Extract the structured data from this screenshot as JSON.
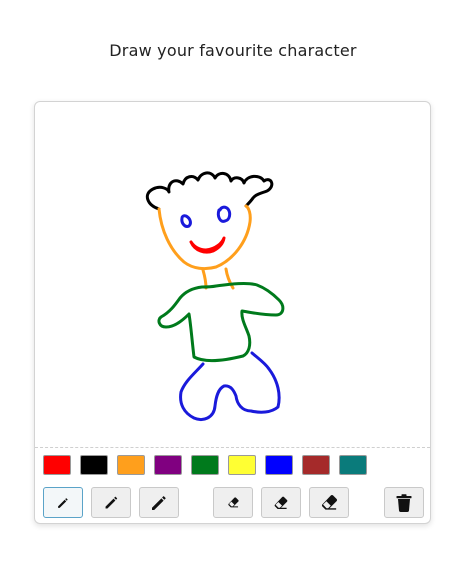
{
  "prompt": "Draw your favourite character",
  "palette": [
    {
      "name": "red",
      "color": "#ff0000"
    },
    {
      "name": "black",
      "color": "#000000"
    },
    {
      "name": "orange",
      "color": "#ff9f1c"
    },
    {
      "name": "purple",
      "color": "#800080"
    },
    {
      "name": "green",
      "color": "#007a1c"
    },
    {
      "name": "yellow",
      "color": "#ffff33"
    },
    {
      "name": "blue",
      "color": "#0000ff"
    },
    {
      "name": "brown",
      "color": "#a52a2a"
    },
    {
      "name": "teal",
      "color": "#0a7b7b"
    }
  ],
  "tools": {
    "pencil_small": {
      "icon": "pencil-icon",
      "size": "small",
      "selected": true
    },
    "pencil_medium": {
      "icon": "pencil-icon",
      "size": "medium",
      "selected": false
    },
    "pencil_large": {
      "icon": "pencil-icon",
      "size": "large",
      "selected": false
    },
    "eraser_small": {
      "icon": "eraser-icon",
      "size": "small",
      "selected": false
    },
    "eraser_medium": {
      "icon": "eraser-icon",
      "size": "medium",
      "selected": false
    },
    "eraser_large": {
      "icon": "eraser-icon",
      "size": "large",
      "selected": false
    },
    "clear": {
      "icon": "trash-icon"
    }
  },
  "drawing_colors": {
    "hair": "#000000",
    "face": "#ff9f1c",
    "eyes": "#1a1adb",
    "mouth": "#ff0000",
    "shirt": "#007a1c",
    "pants": "#1a1adb"
  }
}
